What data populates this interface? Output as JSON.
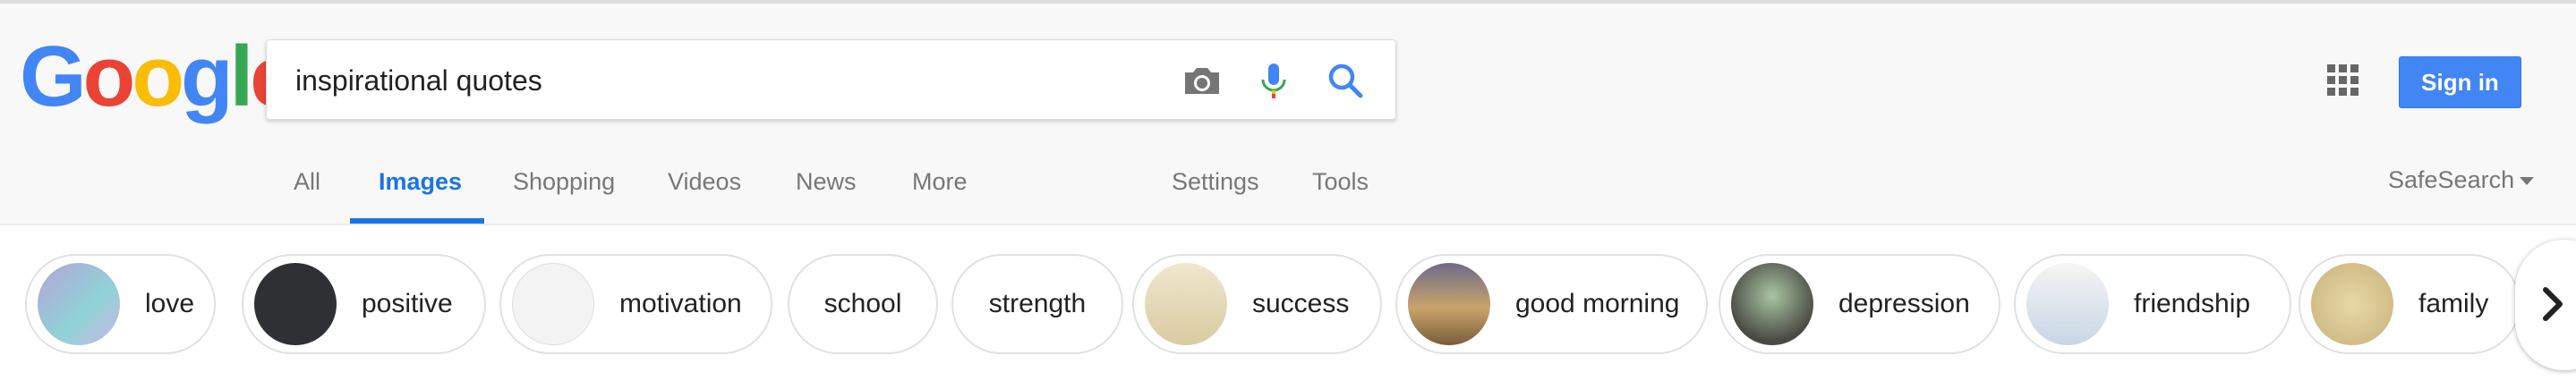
{
  "logo": {
    "text": "Google",
    "letters": [
      "G",
      "o",
      "o",
      "g",
      "l",
      "e"
    ],
    "colors": [
      "#4285f4",
      "#ea4335",
      "#fbbc05",
      "#4285f4",
      "#34a853",
      "#ea4335"
    ]
  },
  "search": {
    "value": "inspirational quotes",
    "placeholder": ""
  },
  "icons": {
    "camera": "camera-icon",
    "mic": "mic-icon",
    "search": "search-icon",
    "apps": "apps-grid-icon",
    "next": "chevron-right-icon"
  },
  "header": {
    "sign_in_label": "Sign in",
    "accent": "#4285f4"
  },
  "tabs": [
    {
      "label": "All",
      "active": false
    },
    {
      "label": "Images",
      "active": true
    },
    {
      "label": "Shopping",
      "active": false
    },
    {
      "label": "Videos",
      "active": false
    },
    {
      "label": "News",
      "active": false
    },
    {
      "label": "More",
      "active": false
    },
    {
      "label": "Settings",
      "active": false
    },
    {
      "label": "Tools",
      "active": false
    }
  ],
  "safesearch_label": "SafeSearch",
  "chips": [
    {
      "label": "love",
      "thumb": true
    },
    {
      "label": "positive",
      "thumb": true
    },
    {
      "label": "motivation",
      "thumb": true
    },
    {
      "label": "school",
      "thumb": false
    },
    {
      "label": "strength",
      "thumb": false
    },
    {
      "label": "success",
      "thumb": true
    },
    {
      "label": "good morning",
      "thumb": true
    },
    {
      "label": "depression",
      "thumb": true
    },
    {
      "label": "friendship",
      "thumb": true
    },
    {
      "label": "family",
      "thumb": true
    }
  ]
}
